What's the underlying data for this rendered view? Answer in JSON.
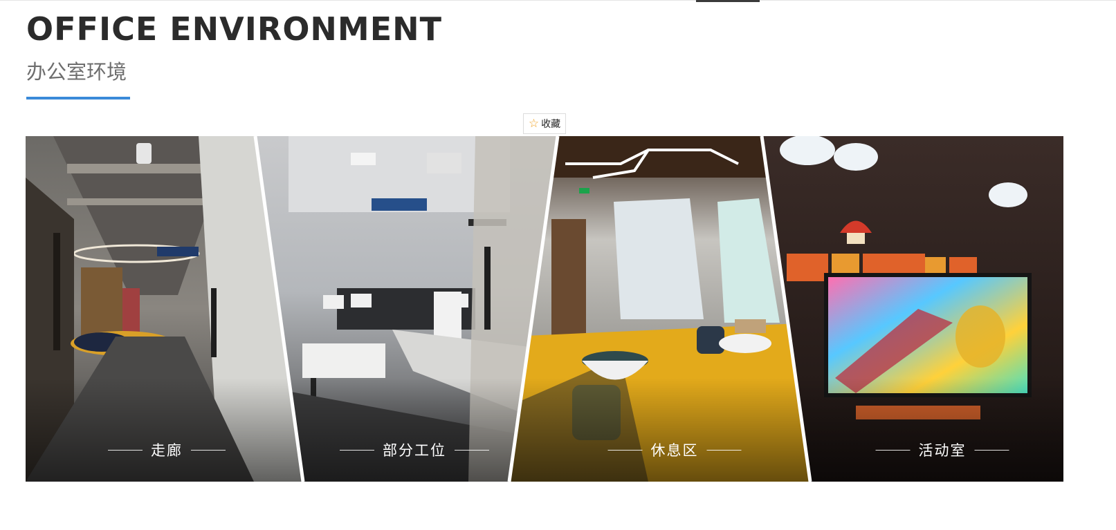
{
  "section": {
    "title_en": "OFFICE ENVIRONMENT",
    "title_cn": "办公室环境",
    "accent_color": "#3a8ad9"
  },
  "favorite": {
    "label": "收藏",
    "icon": "star-outline-icon",
    "icon_color": "#f0a020"
  },
  "gallery": {
    "panels": [
      {
        "name": "corridor",
        "caption": "走廊"
      },
      {
        "name": "workstations",
        "caption": "部分工位"
      },
      {
        "name": "lounge",
        "caption": "休息区"
      },
      {
        "name": "activity-room",
        "caption": "活动室"
      }
    ]
  }
}
